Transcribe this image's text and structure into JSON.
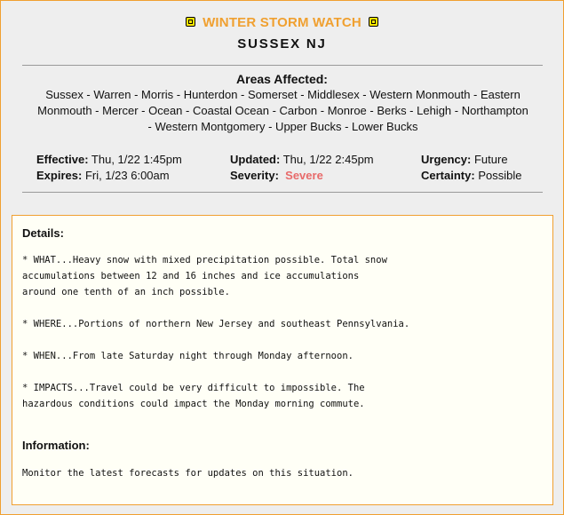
{
  "header": {
    "headline": "WINTER STORM WATCH",
    "left_icon": "warning-icon",
    "right_icon": "warning-icon",
    "location": "SUSSEX NJ"
  },
  "areas": {
    "title": "Areas Affected:",
    "lines": [
      "Sussex - Warren - Morris - Hunterdon - Somerset - Middlesex - Western Monmouth - Eastern",
      "Monmouth - Mercer - Ocean - Coastal Ocean - Carbon - Monroe - Berks - Lehigh - Northampton",
      "- Western Montgomery - Upper Bucks - Lower Bucks"
    ]
  },
  "meta": {
    "effective_label": "Effective:",
    "effective_value": "Thu, 1/22 1:45pm",
    "expires_label": "Expires:",
    "expires_value": "Fri, 1/23 6:00am",
    "updated_label": "Updated:",
    "updated_value": "Thu, 1/22 2:45pm",
    "severity_label": "Severity:",
    "severity_value": "Severe",
    "urgency_label": "Urgency:",
    "urgency_value": "Future",
    "certainty_label": "Certainty:",
    "certainty_value": "Possible"
  },
  "colors": {
    "accent": "#f0a030",
    "severity": "#e86a6a",
    "icon_fill": "#ffe800"
  },
  "details": {
    "title": "Details:",
    "what": "* WHAT...Heavy snow with mixed precipitation possible. Total snow\naccumulations between 12 and 16 inches and ice accumulations\naround one tenth of an inch possible.",
    "where": "* WHERE...Portions of northern New Jersey and southeast Pennsylvania.",
    "when": "* WHEN...From late Saturday night through Monday afternoon.",
    "impacts": "* IMPACTS...Travel could be very difficult to impossible. The\nhazardous conditions could impact the Monday morning commute."
  },
  "information": {
    "title": "Information:",
    "text": "Monitor the latest forecasts for updates on this situation."
  }
}
